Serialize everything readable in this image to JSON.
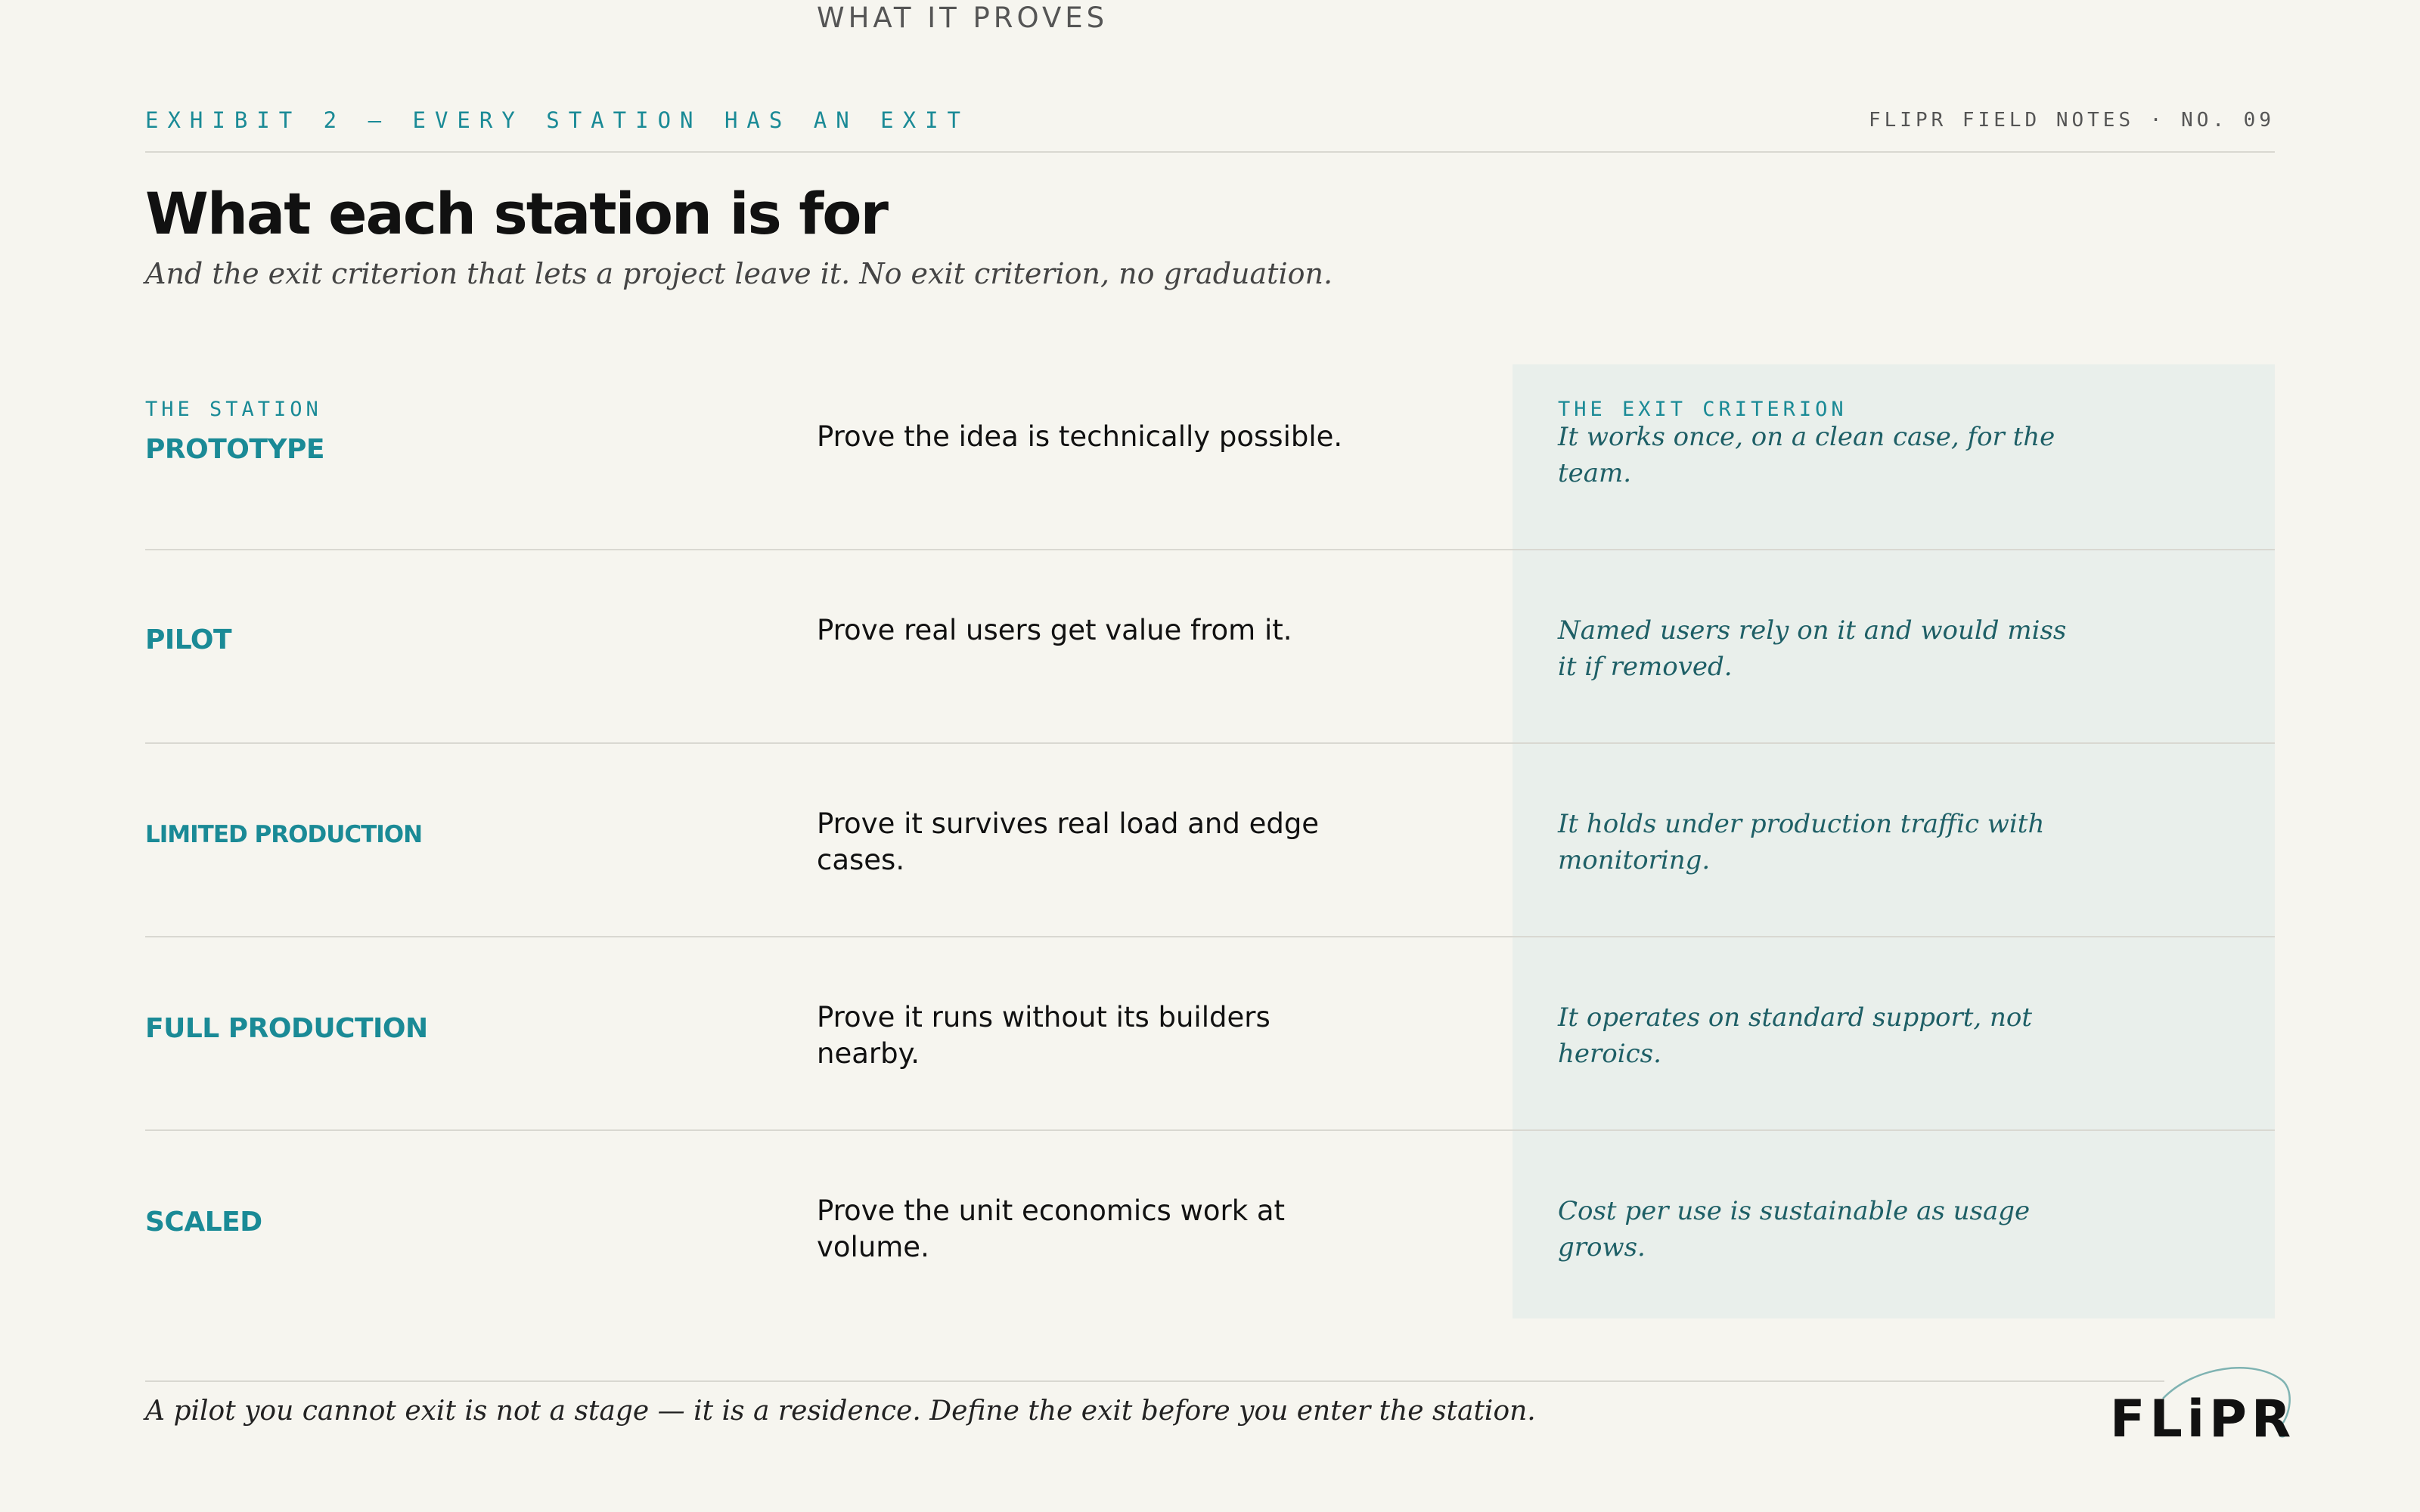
{
  "header": {
    "kicker": "EXHIBIT 2 — EVERY STATION HAS AN EXIT",
    "series": "FLIPR FIELD NOTES · NO. 09"
  },
  "title": "What each station is for",
  "subtitle": "And the exit criterion that lets a project leave it. No exit criterion, no graduation.",
  "table": {
    "columns": {
      "station": "THE STATION",
      "proves": "WHAT IT PROVES",
      "exit": "THE EXIT CRITERION"
    },
    "rows": [
      {
        "station": "PROTOTYPE",
        "proves": "Prove the idea is technically possible.",
        "exit": "It works once, on a clean case, for the team."
      },
      {
        "station": "PILOT",
        "proves": "Prove real users get value from it.",
        "exit": "Named users rely on it and would miss it if removed."
      },
      {
        "station": "LIMITED PRODUCTION",
        "proves": "Prove it survives real load and edge cases.",
        "exit": "It holds under production traffic with monitoring."
      },
      {
        "station": "FULL PRODUCTION",
        "proves": "Prove it runs without its builders nearby.",
        "exit": "It operates on standard support, not heroics."
      },
      {
        "station": "SCALED",
        "proves": "Prove the unit economics work at volume.",
        "exit": "Cost per use is sustainable as usage grows."
      }
    ]
  },
  "footnote": "A pilot you cannot exit is not a stage — it is a residence. Define the exit before you enter the station.",
  "logo": {
    "text": "FLiPR"
  },
  "colors": {
    "accent": "#1a8a96",
    "exit_text": "#1e5f66",
    "exit_panel": "#e9efeb",
    "background": "#f6f5ef"
  }
}
